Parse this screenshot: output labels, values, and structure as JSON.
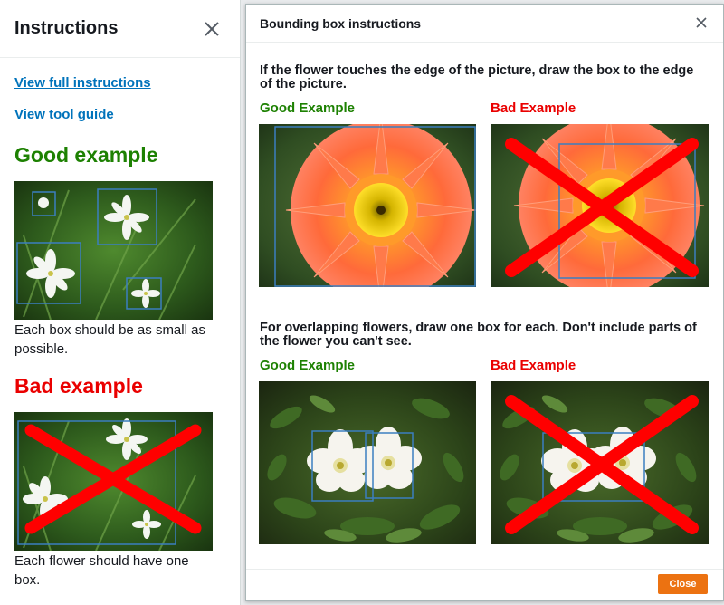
{
  "sidebar": {
    "title": "Instructions",
    "links": {
      "full_instructions": "View full instructions",
      "tool_guide": "View tool guide"
    },
    "good_heading": "Good example",
    "good_caption": "Each box should be as small as possible.",
    "bad_heading": "Bad example",
    "bad_caption": "Each flower should have one box."
  },
  "modal": {
    "title": "Bounding box instructions",
    "section1": {
      "text": "If the flower touches the edge of the picture, draw the box to the edge of the picture.",
      "good_label": "Good Example",
      "bad_label": "Bad Example"
    },
    "section2": {
      "text": "For overlapping flowers, draw one box for each. Don't include parts of the flower you can't see.",
      "good_label": "Good Example",
      "bad_label": "Bad Example"
    },
    "close_button": "Close"
  },
  "colors": {
    "good_text": "#1d8102",
    "bad_text": "#ea0000",
    "link": "#0073bb",
    "bounding_box": "#3b7ec0",
    "cross_mark": "#ff0000",
    "close_button_bg": "#ec7211"
  },
  "icons": {
    "sidebar_close": "close-icon",
    "modal_close": "close-icon"
  }
}
